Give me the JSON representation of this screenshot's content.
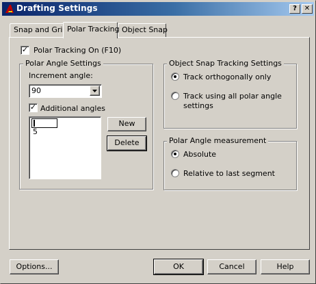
{
  "window": {
    "title": "Drafting Settings",
    "help_button": "?",
    "close_button": "✕"
  },
  "tabs": [
    {
      "label": "Snap and Grid",
      "active": false
    },
    {
      "label": "Polar Tracking",
      "active": true
    },
    {
      "label": "Object Snap",
      "active": false
    }
  ],
  "polar_tracking_on": {
    "label": "Polar Tracking On (F10)",
    "checked": true
  },
  "polar_angle_settings": {
    "legend": "Polar Angle Settings",
    "increment_label": "Increment angle:",
    "increment_value": "90",
    "additional_angles": {
      "label": "Additional angles",
      "checked": true
    },
    "angles_list": [
      "",
      "5"
    ],
    "new_button": "New",
    "delete_button": "Delete"
  },
  "object_snap_tracking": {
    "legend": "Object Snap Tracking Settings",
    "options": [
      {
        "label": "Track orthogonally only",
        "selected": true
      },
      {
        "label": "Track using all polar angle settings",
        "label_line1": "Track using all polar angle",
        "label_line2": "settings",
        "selected": false
      }
    ]
  },
  "polar_angle_measurement": {
    "legend": "Polar Angle measurement",
    "options": [
      {
        "label": "Absolute",
        "selected": true
      },
      {
        "label": "Relative to last segment",
        "selected": false
      }
    ]
  },
  "footer": {
    "options_button": "Options...",
    "ok_button": "OK",
    "cancel_button": "Cancel",
    "help_button": "Help"
  },
  "colors": {
    "face": "#d4d0c8",
    "title_start": "#0a246a",
    "title_end": "#a6caf0"
  }
}
